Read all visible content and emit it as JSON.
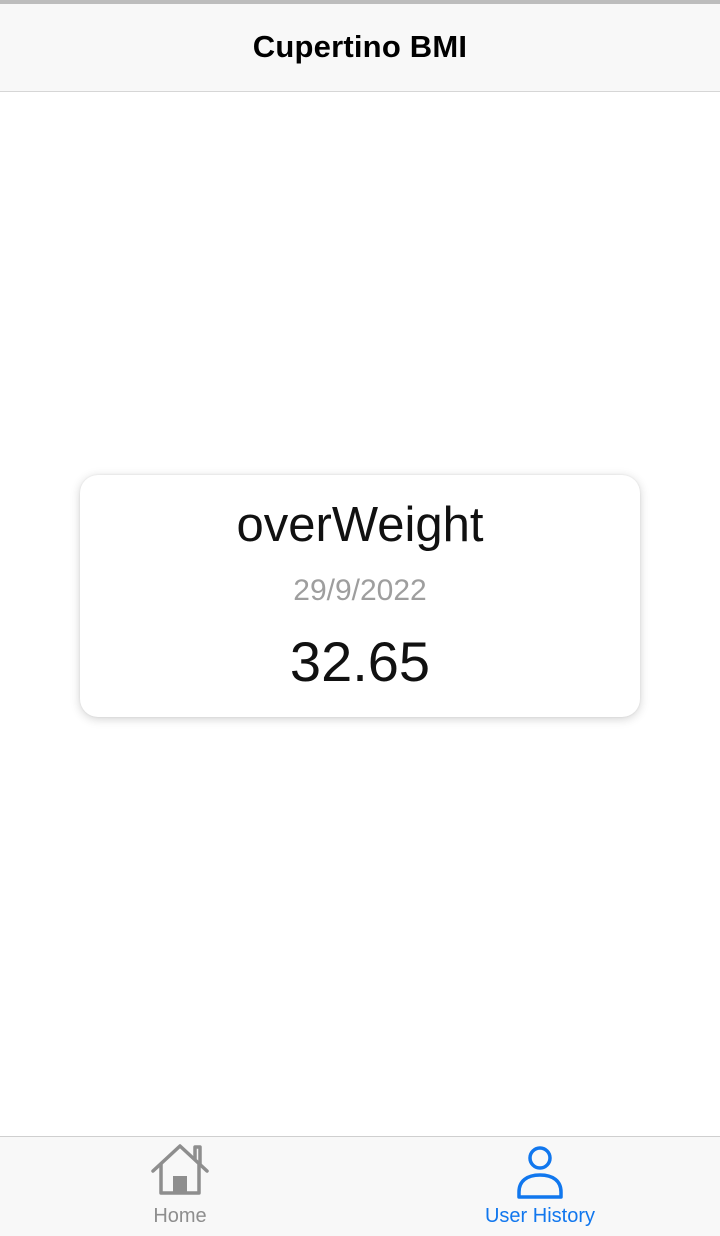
{
  "nav_bar": {
    "title": "Cupertino BMI"
  },
  "history_card": {
    "category": "overWeight",
    "date": "29/9/2022",
    "bmi_value": "32.65"
  },
  "tab_bar": {
    "tabs": [
      {
        "label": "Home",
        "icon": "home-icon",
        "active": false,
        "color": "#8e8e8e"
      },
      {
        "label": "User History",
        "icon": "person-icon",
        "active": true,
        "color": "#1177ee"
      }
    ]
  }
}
